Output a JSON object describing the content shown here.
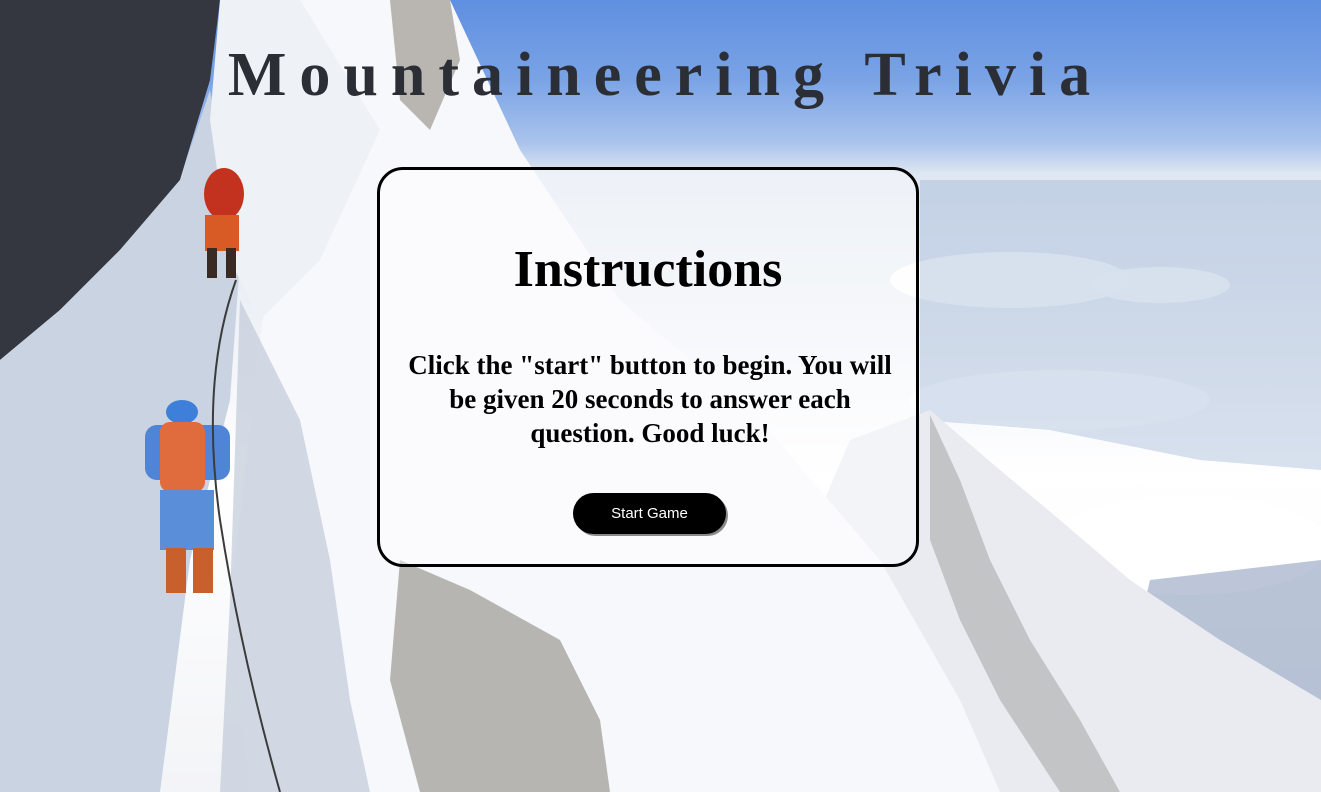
{
  "page": {
    "title": "Mountaineering Trivia"
  },
  "instructions": {
    "heading": "Instructions",
    "body": "Click the \"start\" button to begin. You will be given 20 seconds to answer each question. Good luck!",
    "start_button_label": "Start Game"
  },
  "colors": {
    "sky": "#6f9ae3",
    "title_text": "#2b2e35",
    "button_bg": "#000000",
    "button_text": "#ffffff",
    "card_border": "#000000"
  }
}
